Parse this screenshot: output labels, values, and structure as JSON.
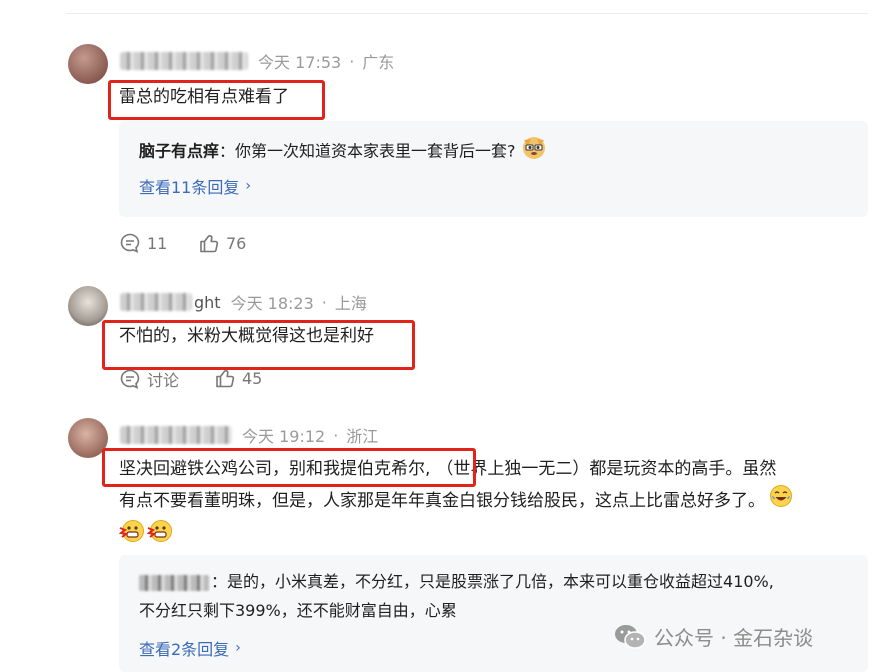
{
  "comments": [
    {
      "username_masked": "",
      "meta": {
        "time": "今天 17:53",
        "sep": "·",
        "location": "广东"
      },
      "content": "雷总的吃相有点难看了",
      "reply": {
        "author": "脑子有点痒",
        "colon": "：",
        "text": "你第一次知道资本家表里一套背后一套?",
        "emoji": "doge-emoji"
      },
      "view_replies": "查看11条回复",
      "comment_count": "11",
      "like_count": "76"
    },
    {
      "username_suffix": "ght",
      "meta": {
        "time": "今天 18:23",
        "sep": "·",
        "location": "上海"
      },
      "content": "不怕的，米粉大概觉得这也是利好",
      "discuss_label": "讨论",
      "like_count": "45"
    },
    {
      "meta": {
        "time": "今天 19:12",
        "sep": "·",
        "location": "浙江"
      },
      "content_boxed": "坚决回避铁公鸡公司，别和我提伯克希尔,",
      "content_rest": "（世界上独一无二）都是玩资本的高手。虽然",
      "content_line2": "有点不要看董明珠，但是，人家那是年年真金白银分钱给股民，这点上比雷总好多了。",
      "reply": {
        "colon": "：",
        "line1": "是的，小米真差，不分红，只是股票涨了几倍，本来可以重仓收益超过410%,",
        "line2": "不分红只剩下399%，还不能财富自由，心累"
      },
      "view_replies": "查看2条回复"
    }
  ],
  "watermark": {
    "label": "公众号 · 金石杂谈"
  },
  "colors": {
    "highlight": "#e2231a",
    "link": "#3a6ab8",
    "meta": "#9a9a9a"
  }
}
